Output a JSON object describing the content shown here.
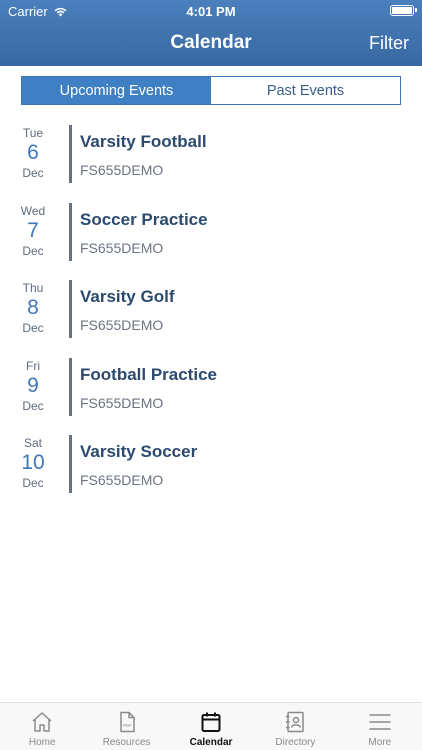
{
  "status_bar": {
    "carrier": "Carrier",
    "time": "4:01 PM"
  },
  "header": {
    "title": "Calendar",
    "filter_label": "Filter"
  },
  "segments": {
    "upcoming": "Upcoming Events",
    "past": "Past Events",
    "selected": "upcoming"
  },
  "events": [
    {
      "dow": "Tue",
      "day": "6",
      "month": "Dec",
      "title": "Varsity Football",
      "org": "FS655DEMO"
    },
    {
      "dow": "Wed",
      "day": "7",
      "month": "Dec",
      "title": "Soccer Practice",
      "org": "FS655DEMO"
    },
    {
      "dow": "Thu",
      "day": "8",
      "month": "Dec",
      "title": "Varsity Golf",
      "org": "FS655DEMO"
    },
    {
      "dow": "Fri",
      "day": "9",
      "month": "Dec",
      "title": "Football Practice",
      "org": "FS655DEMO"
    },
    {
      "dow": "Sat",
      "day": "10",
      "month": "Dec",
      "title": "Varsity Soccer",
      "org": "FS655DEMO"
    }
  ],
  "tabbar": {
    "items": [
      {
        "label": "Home",
        "icon": "home-icon"
      },
      {
        "label": "Resources",
        "icon": "pdf-document-icon"
      },
      {
        "label": "Calendar",
        "icon": "calendar-icon",
        "active": true
      },
      {
        "label": "Directory",
        "icon": "contact-card-icon"
      },
      {
        "label": "More",
        "icon": "hamburger-menu-icon"
      }
    ]
  },
  "colors": {
    "header_blue": "#3f78ba",
    "accent": "#3f7fc4",
    "title_text": "#2c4a6e"
  }
}
